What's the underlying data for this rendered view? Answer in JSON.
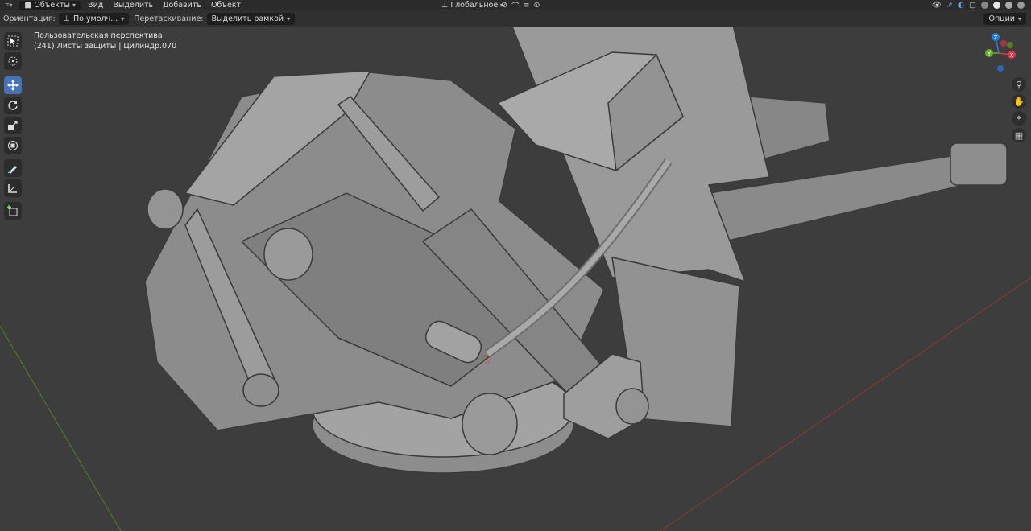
{
  "topbar": {
    "mode_label": "Объекты",
    "menu": [
      "Вид",
      "Выделить",
      "Добавить",
      "Объект"
    ],
    "transform_orientation": "Глобальное"
  },
  "toolrow": {
    "orientation_label": "Ориентация:",
    "orientation_value": "По умолч...",
    "drag_label": "Перетаскивание:",
    "drag_value": "Выделить рамкой",
    "options_label": "Опции"
  },
  "viewport": {
    "view_name": "Пользовательская перспектива",
    "object_info": "(241) Листы защиты | Цилиндр.070"
  },
  "gizmo": {
    "axes": [
      {
        "label": "Z",
        "color": "#2a7de1"
      },
      {
        "label": "Y",
        "color": "#6cab1f"
      },
      {
        "label": "X",
        "color": "#e0364b"
      }
    ]
  },
  "left_tools": [
    {
      "name": "select-box-tool",
      "icon": "cursor-box-icon",
      "active": false
    },
    {
      "name": "cursor-tool",
      "icon": "cursor-circle-icon",
      "active": false
    },
    {
      "name": "move-tool",
      "icon": "move-arrows-icon",
      "active": true
    },
    {
      "name": "rotate-tool",
      "icon": "rotate-icon",
      "active": false
    },
    {
      "name": "scale-tool",
      "icon": "scale-icon",
      "active": false
    },
    {
      "name": "transform-tool",
      "icon": "transform-icon",
      "active": false
    },
    {
      "name": "annotate-tool",
      "icon": "pencil-icon",
      "active": false
    },
    {
      "name": "measure-tool",
      "icon": "ruler-icon",
      "active": false
    },
    {
      "name": "add-cube-tool",
      "icon": "add-cube-icon",
      "active": false
    }
  ],
  "colors": {
    "accent": "#4772b3",
    "x_axis_line": "#8a3a3a",
    "y_axis_line": "#5b7a2a",
    "model_fill": "#8f8f8f"
  }
}
